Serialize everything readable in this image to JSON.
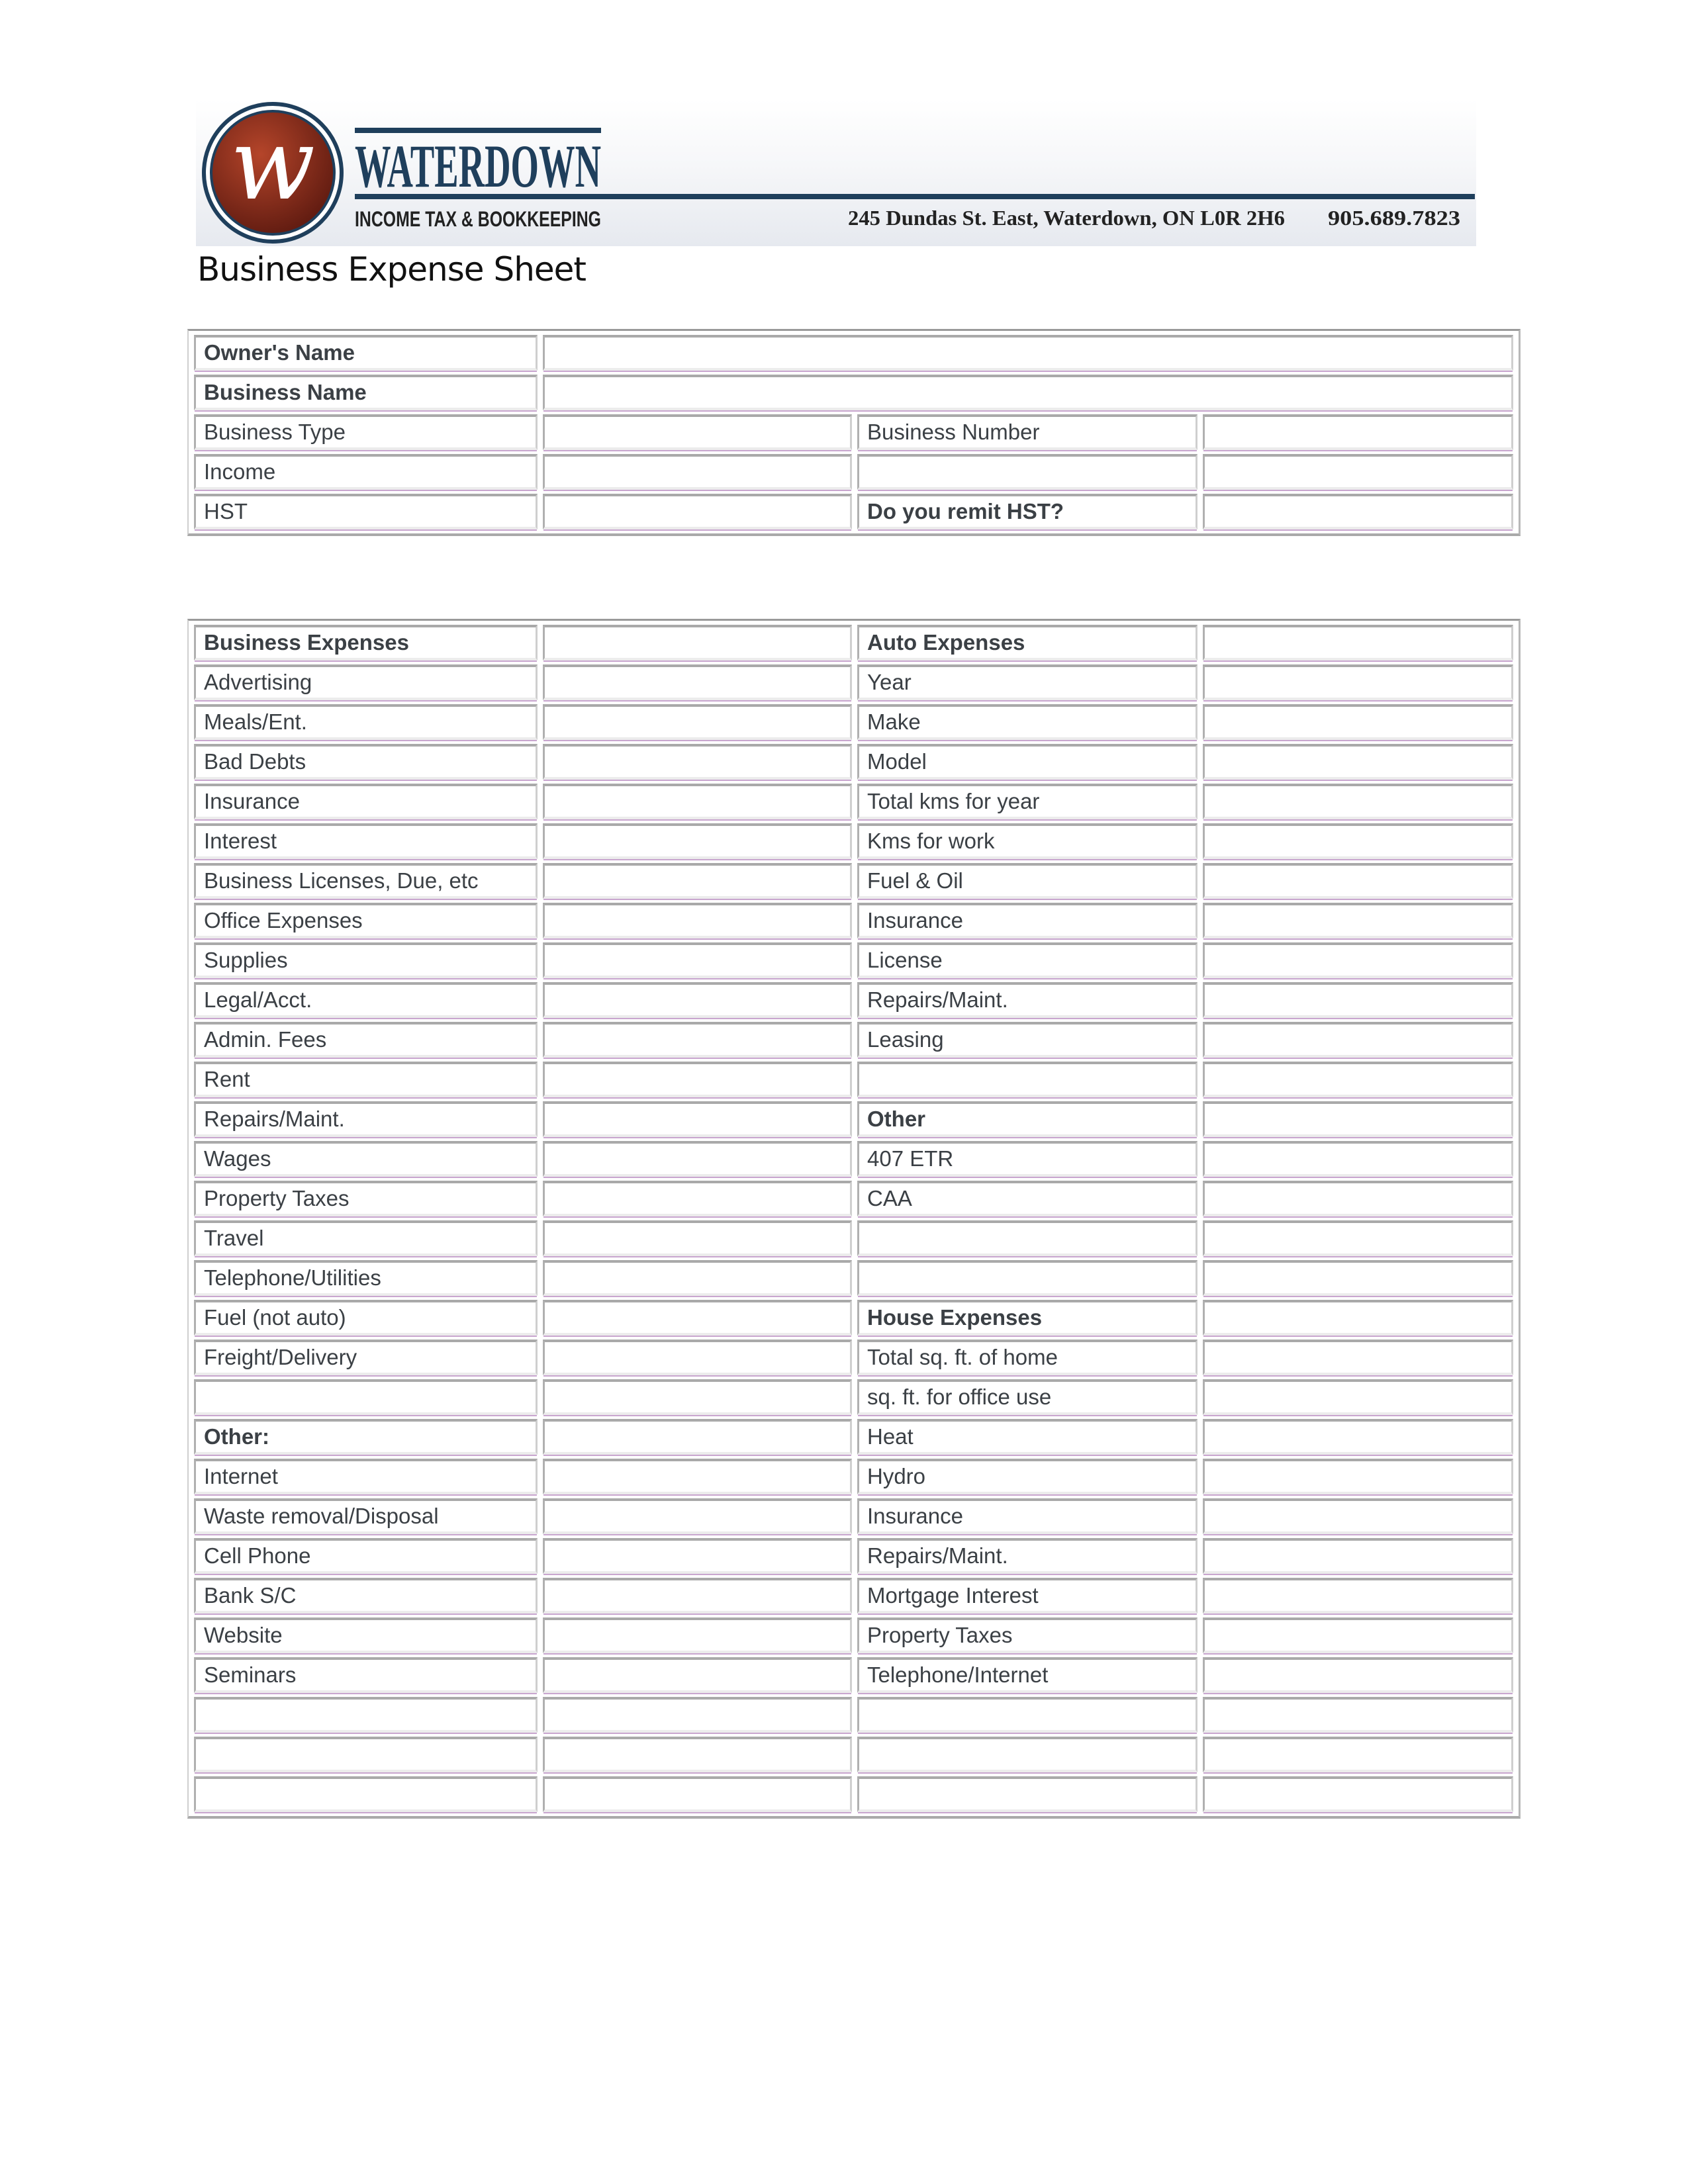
{
  "header": {
    "brand": "WATERDOWN",
    "tagline": "INCOME TAX & BOOKKEEPING",
    "address": "245 Dundas St. East, Waterdown, ON  L0R 2H6",
    "phone": "905.689.7823",
    "logo_letter": "w",
    "colors": {
      "navy": "#1f3f5c",
      "maroon": "#8b2d1c"
    }
  },
  "title": "Business Expense Sheet",
  "info_table": {
    "rows": [
      {
        "label": "Owner's Name",
        "bold": true,
        "span": true
      },
      {
        "label": "Business Name",
        "bold": true,
        "span": true
      },
      {
        "label": "Business Type",
        "label2": "Business Number"
      },
      {
        "label": "Income",
        "label2": ""
      },
      {
        "label": "HST",
        "label2": "Do you remit HST?",
        "bold2": true
      }
    ]
  },
  "expense_table": {
    "rows": [
      {
        "left": "Business Expenses",
        "lb": true,
        "right": "Auto Expenses",
        "rb": true
      },
      {
        "left": "Advertising",
        "right": "Year"
      },
      {
        "left": "Meals/Ent.",
        "right": "Make"
      },
      {
        "left": "Bad Debts",
        "right": "Model"
      },
      {
        "left": "Insurance",
        "right": "Total kms for year"
      },
      {
        "left": "Interest",
        "right": "Kms for work"
      },
      {
        "left": "Business Licenses, Due, etc",
        "right": "Fuel & Oil"
      },
      {
        "left": "Office Expenses",
        "right": "Insurance"
      },
      {
        "left": "Supplies",
        "right": "License"
      },
      {
        "left": "Legal/Acct.",
        "right": "Repairs/Maint."
      },
      {
        "left": "Admin. Fees",
        "right": "Leasing"
      },
      {
        "left": "Rent",
        "right": ""
      },
      {
        "left": "Repairs/Maint.",
        "right": "Other",
        "rb": true
      },
      {
        "left": "Wages",
        "right": "407 ETR"
      },
      {
        "left": "Property Taxes",
        "right": "CAA"
      },
      {
        "left": "Travel",
        "right": ""
      },
      {
        "left": "Telephone/Utilities",
        "right": ""
      },
      {
        "left": "Fuel (not auto)",
        "right": "House Expenses",
        "rb": true
      },
      {
        "left": "Freight/Delivery",
        "right": "Total sq. ft. of home"
      },
      {
        "left": "",
        "right": "sq. ft. for office use"
      },
      {
        "left": "Other:",
        "lb": true,
        "right": "Heat"
      },
      {
        "left": "Internet",
        "right": "Hydro"
      },
      {
        "left": "Waste removal/Disposal",
        "right": "Insurance"
      },
      {
        "left": "Cell Phone",
        "right": "Repairs/Maint."
      },
      {
        "left": "Bank S/C",
        "right": "Mortgage Interest"
      },
      {
        "left": "Website",
        "right": "Property Taxes"
      },
      {
        "left": "Seminars",
        "right": "Telephone/Internet"
      },
      {
        "left": "",
        "right": ""
      },
      {
        "left": "",
        "right": ""
      },
      {
        "left": "",
        "right": ""
      }
    ]
  }
}
